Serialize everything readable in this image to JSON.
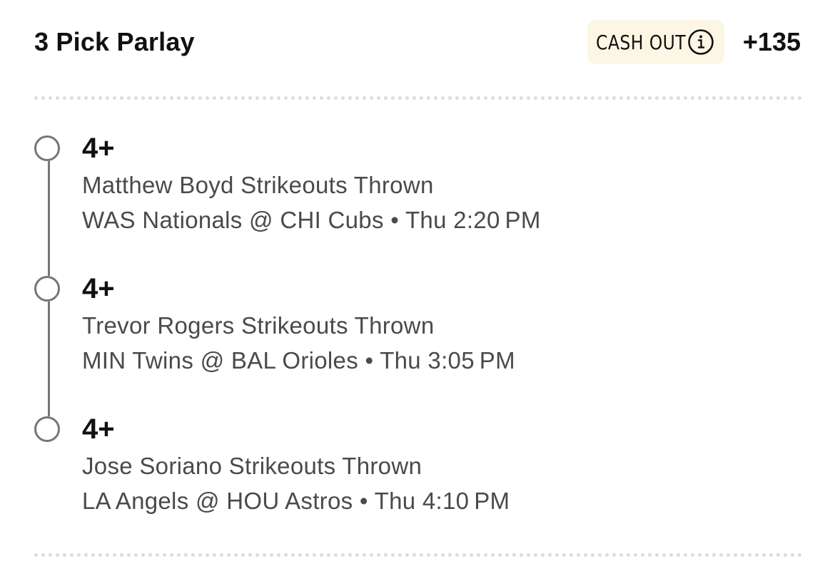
{
  "header": {
    "title": "3 Pick Parlay",
    "cash_out_label": "CASH OUT",
    "info_icon": "info-circle-icon",
    "odds": "+135"
  },
  "legs": [
    {
      "threshold": "4+",
      "market": "Matthew Boyd Strikeouts Thrown",
      "game": "WAS Nationals @ CHI Cubs • Thu 2:20 PM"
    },
    {
      "threshold": "4+",
      "market": "Trevor Rogers Strikeouts Thrown",
      "game": "MIN Twins @ BAL Orioles • Thu 3:05 PM"
    },
    {
      "threshold": "4+",
      "market": "Jose Soriano Strikeouts Thrown",
      "game": "LA Angels @ HOU Astros • Thu 4:10 PM"
    }
  ],
  "colors": {
    "cash_out_bg": "#fcf7e4",
    "timeline": "#767676",
    "secondary_text": "#4a4a4a",
    "divider": "#dcdcdc"
  }
}
